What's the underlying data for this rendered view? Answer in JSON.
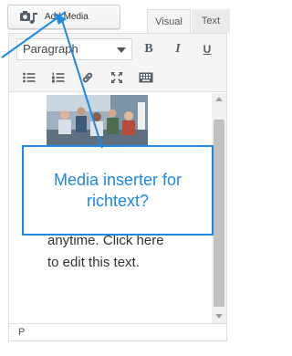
{
  "add_media": {
    "label": "Add Media",
    "icon": "media-camera-note-icon"
  },
  "tabs": [
    {
      "label": "Visual"
    },
    {
      "label": "Text"
    }
  ],
  "toolbar": {
    "format_select": "Paragraph",
    "bold_label": "B",
    "italic_label": "I",
    "underline_label": "U",
    "icons": [
      "bullet-list-icon",
      "numbered-list-icon",
      "link-icon",
      "fullscreen-icon",
      "keyboard-icon"
    ]
  },
  "content": {
    "body_text": "anytime. Click here to edit this text."
  },
  "statusbar": {
    "path": "P"
  },
  "annotation": {
    "text": "Media inserter for richtext?"
  },
  "colors": {
    "annotation_blue": "#1e88e5",
    "toolbar_bg": "#f5f5f5",
    "scrollbar_thumb": "#c1c1c1"
  }
}
